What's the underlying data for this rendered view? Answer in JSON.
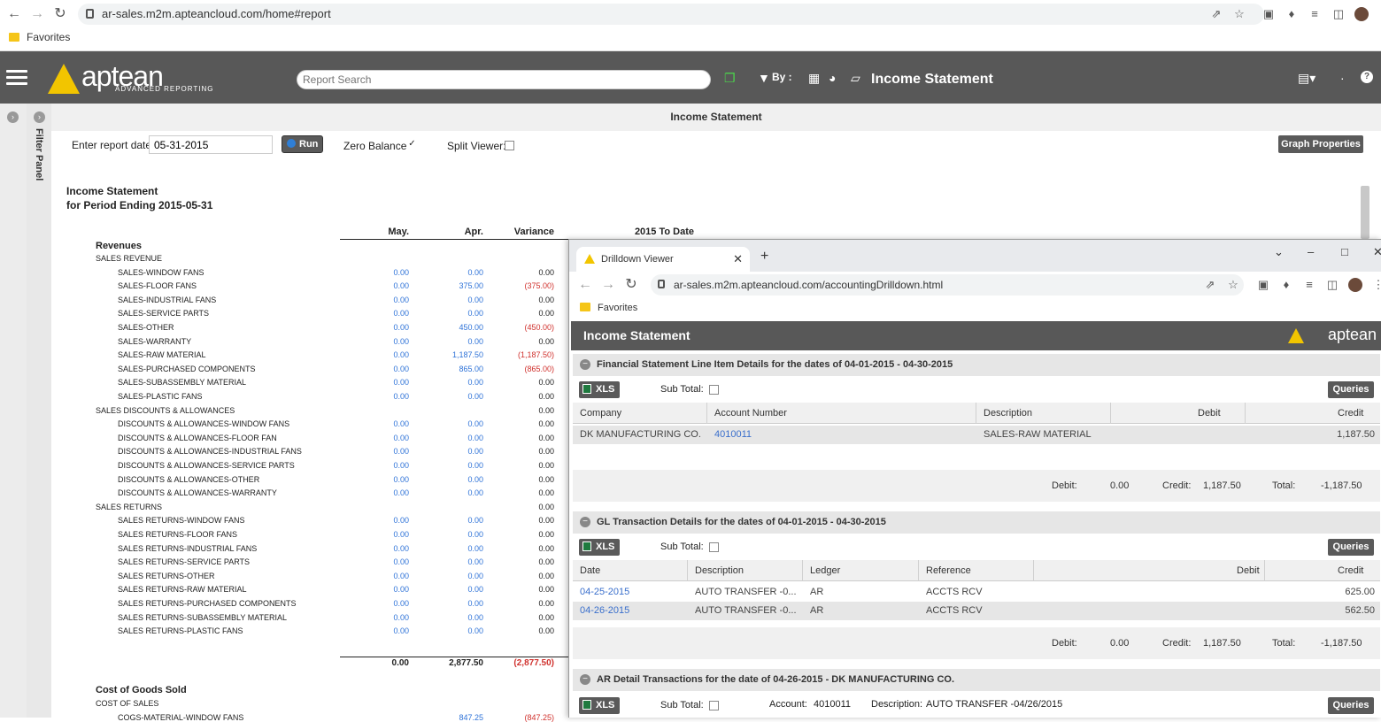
{
  "browser": {
    "url": "ar-sales.m2m.apteancloud.com/home#report",
    "bookmark": "Favorites"
  },
  "app": {
    "brand": "aptean",
    "brand_sub": "ADVANCED REPORTING",
    "search_placeholder": "Report Search",
    "by_label": "By :",
    "title": "Income Statement"
  },
  "report": {
    "title_bar": "Income Statement",
    "filter_panel": "Filter Panel",
    "date_label": "Enter report date:",
    "date_value": "05-31-2015",
    "run": "Run",
    "zero_balance": "Zero Balance:",
    "split_viewer": "Split Viewer:",
    "graph_properties": "Graph Properties",
    "heading1": "Income Statement",
    "heading2": "for Period Ending 2015-05-31",
    "columns": {
      "may": "May.",
      "apr": "Apr.",
      "variance": "Variance",
      "ytd": "2015 To Date"
    },
    "section_revenues": "Revenues",
    "rows": [
      {
        "name": "SALES REVENUE",
        "indent": 0,
        "may": "",
        "apr": "",
        "var": "",
        "neg": false
      },
      {
        "name": "SALES-WINDOW FANS",
        "indent": 1,
        "may": "0.00",
        "apr": "0.00",
        "var": "0.00",
        "neg": false
      },
      {
        "name": "SALES-FLOOR FANS",
        "indent": 1,
        "may": "0.00",
        "apr": "375.00",
        "var": "(375.00)",
        "neg": true
      },
      {
        "name": "SALES-INDUSTRIAL FANS",
        "indent": 1,
        "may": "0.00",
        "apr": "0.00",
        "var": "0.00",
        "neg": false
      },
      {
        "name": "SALES-SERVICE PARTS",
        "indent": 1,
        "may": "0.00",
        "apr": "0.00",
        "var": "0.00",
        "neg": false
      },
      {
        "name": "SALES-OTHER",
        "indent": 1,
        "may": "0.00",
        "apr": "450.00",
        "var": "(450.00)",
        "neg": true
      },
      {
        "name": "SALES-WARRANTY",
        "indent": 1,
        "may": "0.00",
        "apr": "0.00",
        "var": "0.00",
        "neg": false
      },
      {
        "name": "SALES-RAW MATERIAL",
        "indent": 1,
        "may": "0.00",
        "apr": "1,187.50",
        "var": "(1,187.50)",
        "neg": true
      },
      {
        "name": "SALES-PURCHASED COMPONENTS",
        "indent": 1,
        "may": "0.00",
        "apr": "865.00",
        "var": "(865.00)",
        "neg": true
      },
      {
        "name": "SALES-SUBASSEMBLY MATERIAL",
        "indent": 1,
        "may": "0.00",
        "apr": "0.00",
        "var": "0.00",
        "neg": false
      },
      {
        "name": "SALES-PLASTIC FANS",
        "indent": 1,
        "may": "0.00",
        "apr": "0.00",
        "var": "0.00",
        "neg": false
      },
      {
        "name": "SALES DISCOUNTS & ALLOWANCES",
        "indent": 0,
        "may": "",
        "apr": "",
        "var": "0.00",
        "neg": false
      },
      {
        "name": "DISCOUNTS & ALLOWANCES-WINDOW FANS",
        "indent": 1,
        "may": "0.00",
        "apr": "0.00",
        "var": "0.00",
        "neg": false
      },
      {
        "name": "DISCOUNTS & ALLOWANCES-FLOOR FAN",
        "indent": 1,
        "may": "0.00",
        "apr": "0.00",
        "var": "0.00",
        "neg": false
      },
      {
        "name": "DISCOUNTS & ALLOWANCES-INDUSTRIAL FANS",
        "indent": 1,
        "may": "0.00",
        "apr": "0.00",
        "var": "0.00",
        "neg": false
      },
      {
        "name": "DISCOUNTS & ALLOWANCES-SERVICE PARTS",
        "indent": 1,
        "may": "0.00",
        "apr": "0.00",
        "var": "0.00",
        "neg": false
      },
      {
        "name": "DISCOUNTS & ALLOWANCES-OTHER",
        "indent": 1,
        "may": "0.00",
        "apr": "0.00",
        "var": "0.00",
        "neg": false
      },
      {
        "name": "DISCOUNTS & ALLOWANCES-WARRANTY",
        "indent": 1,
        "may": "0.00",
        "apr": "0.00",
        "var": "0.00",
        "neg": false
      },
      {
        "name": "SALES RETURNS",
        "indent": 0,
        "may": "",
        "apr": "",
        "var": "0.00",
        "neg": false
      },
      {
        "name": "SALES RETURNS-WINDOW FANS",
        "indent": 1,
        "may": "0.00",
        "apr": "0.00",
        "var": "0.00",
        "neg": false
      },
      {
        "name": "SALES RETURNS-FLOOR FANS",
        "indent": 1,
        "may": "0.00",
        "apr": "0.00",
        "var": "0.00",
        "neg": false
      },
      {
        "name": "SALES RETURNS-INDUSTRIAL FANS",
        "indent": 1,
        "may": "0.00",
        "apr": "0.00",
        "var": "0.00",
        "neg": false
      },
      {
        "name": "SALES RETURNS-SERVICE PARTS",
        "indent": 1,
        "may": "0.00",
        "apr": "0.00",
        "var": "0.00",
        "neg": false
      },
      {
        "name": "SALES RETURNS-OTHER",
        "indent": 1,
        "may": "0.00",
        "apr": "0.00",
        "var": "0.00",
        "neg": false
      },
      {
        "name": "SALES RETURNS-RAW MATERIAL",
        "indent": 1,
        "may": "0.00",
        "apr": "0.00",
        "var": "0.00",
        "neg": false
      },
      {
        "name": "SALES RETURNS-PURCHASED COMPONENTS",
        "indent": 1,
        "may": "0.00",
        "apr": "0.00",
        "var": "0.00",
        "neg": false
      },
      {
        "name": "SALES RETURNS-SUBASSEMBLY MATERIAL",
        "indent": 1,
        "may": "0.00",
        "apr": "0.00",
        "var": "0.00",
        "neg": false
      },
      {
        "name": "SALES RETURNS-PLASTIC FANS",
        "indent": 1,
        "may": "0.00",
        "apr": "0.00",
        "var": "0.00",
        "neg": false
      }
    ],
    "totals": {
      "may": "0.00",
      "apr": "2,877.50",
      "var": "(2,877.50)"
    },
    "section_cogs": "Cost of Goods Sold",
    "cost_of_sales": "COST OF SALES",
    "cogs_partial": "COGS-MATERIAL-WINDOW FANS",
    "cogs_partial_apr": "847.25",
    "cogs_partial_var": "(847.25)"
  },
  "drill": {
    "tab_title": "Drilldown Viewer",
    "url": "ar-sales.m2m.apteancloud.com/accountingDrilldown.html",
    "bookmark": "Favorites",
    "header": "Income Statement",
    "logo": "aptean",
    "sec1": {
      "title": "Financial Statement Line Item Details for the dates of 04-01-2015 - 04-30-2015",
      "xls": "XLS",
      "subtotal": "Sub Total:",
      "queries": "Queries",
      "cols": [
        "Company",
        "Account Number",
        "Description",
        "Debit",
        "Credit"
      ],
      "row": {
        "company": "DK MANUFACTURING CO.",
        "account": "4010011",
        "description": "SALES-RAW MATERIAL",
        "debit": "",
        "credit": "1,187.50"
      },
      "foot": {
        "debit_l": "Debit:",
        "debit": "0.00",
        "credit_l": "Credit:",
        "credit": "1,187.50",
        "total_l": "Total:",
        "total": "-1,187.50"
      }
    },
    "sec2": {
      "title": "GL Transaction Details for the dates of 04-01-2015 - 04-30-2015",
      "xls": "XLS",
      "subtotal": "Sub Total:",
      "queries": "Queries",
      "cols": [
        "Date",
        "Description",
        "Ledger",
        "Reference",
        "Debit",
        "Credit"
      ],
      "rows": [
        {
          "date": "04-25-2015",
          "desc": "AUTO TRANSFER -0...",
          "ledger": "AR",
          "ref": "ACCTS RCV",
          "credit": "625.00"
        },
        {
          "date": "04-26-2015",
          "desc": "AUTO TRANSFER -0...",
          "ledger": "AR",
          "ref": "ACCTS RCV",
          "credit": "562.50"
        }
      ],
      "foot": {
        "debit_l": "Debit:",
        "debit": "0.00",
        "credit_l": "Credit:",
        "credit": "1,187.50",
        "total_l": "Total:",
        "total": "-1,187.50"
      }
    },
    "sec3": {
      "title": "AR Detail Transactions for the date of 04-26-2015 - DK MANUFACTURING CO.",
      "xls": "XLS",
      "subtotal": "Sub Total:",
      "account_l": "Account:",
      "account": "4010011",
      "desc_l": "Description:",
      "desc": "AUTO TRANSFER -04/26/2015",
      "queries": "Queries"
    }
  }
}
